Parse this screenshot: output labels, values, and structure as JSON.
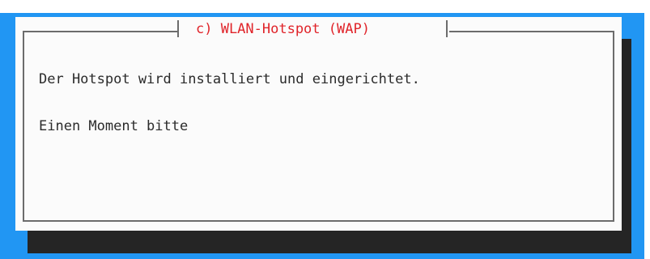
{
  "dialog": {
    "title": "c) WLAN-Hotspot (WAP)",
    "message_line_1": "Der Hotspot wird installiert und eingerichtet.",
    "message_line_2": "Einen Moment bitte"
  },
  "colors": {
    "backdrop": "#2196f3",
    "shadow": "#252525",
    "dialog_background": "#fbfbfb",
    "border": "#6c6c6c",
    "title": "#e0242a",
    "text": "#2b2b2b"
  }
}
